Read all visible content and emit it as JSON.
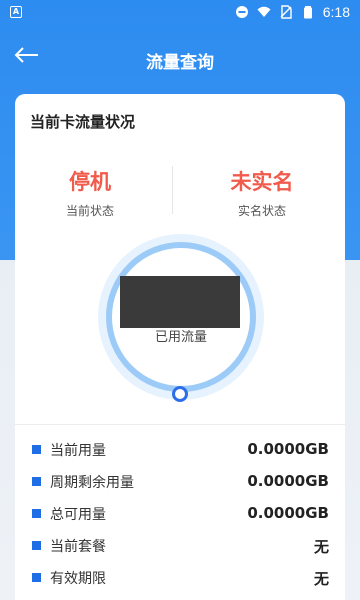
{
  "status_bar": {
    "left_badge": "A",
    "time": "6:18",
    "icons": [
      "minus-circle-icon",
      "wifi-icon",
      "no-sim-icon",
      "battery-icon"
    ]
  },
  "header": {
    "back_icon": "arrow-left-icon",
    "title": "流量查询"
  },
  "card": {
    "title": "当前卡流量状况",
    "status": {
      "value": "停机",
      "label": "当前状态"
    },
    "realname": {
      "value": "未实名",
      "label": "实名状态"
    },
    "usage": {
      "label": "已用流量"
    },
    "details": [
      {
        "label": "当前用量",
        "value": "0.0000GB"
      },
      {
        "label": "周期剩余用量",
        "value": "0.0000GB"
      },
      {
        "label": "总可用量",
        "value": "0.0000GB"
      },
      {
        "label": "当前套餐",
        "value": "无"
      },
      {
        "label": "有效期限",
        "value": "无"
      }
    ]
  },
  "colors": {
    "primary": "#2d8cf0",
    "accent_red": "#f25b4c",
    "bullet_blue": "#1e6fe6",
    "ring_light": "#9ccbf8"
  }
}
